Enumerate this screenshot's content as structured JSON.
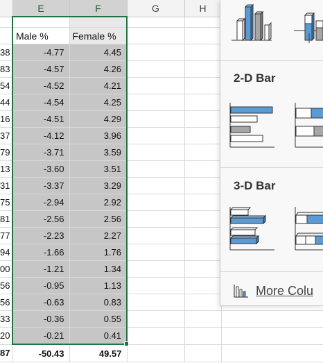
{
  "columns": [
    "E",
    "F",
    "G",
    "H"
  ],
  "headers": {
    "male": "Male %",
    "female": "Female %"
  },
  "rows": [
    {
      "rownum": "38",
      "male": "-4.77",
      "female": "4.45"
    },
    {
      "rownum": "83",
      "male": "-4.57",
      "female": "4.26"
    },
    {
      "rownum": "54",
      "male": "-4.52",
      "female": "4.21"
    },
    {
      "rownum": "44",
      "male": "-4.54",
      "female": "4.25"
    },
    {
      "rownum": "16",
      "male": "-4.51",
      "female": "4.29"
    },
    {
      "rownum": "37",
      "male": "-4.12",
      "female": "3.96"
    },
    {
      "rownum": "79",
      "male": "-3.71",
      "female": "3.59"
    },
    {
      "rownum": "13",
      "male": "-3.60",
      "female": "3.51"
    },
    {
      "rownum": "31",
      "male": "-3.37",
      "female": "3.29"
    },
    {
      "rownum": "75",
      "male": "-2.94",
      "female": "2.92"
    },
    {
      "rownum": "81",
      "male": "-2.56",
      "female": "2.56"
    },
    {
      "rownum": "77",
      "male": "-2.23",
      "female": "2.27"
    },
    {
      "rownum": "94",
      "male": "-1.66",
      "female": "1.76"
    },
    {
      "rownum": "00",
      "male": "-1.21",
      "female": "1.34"
    },
    {
      "rownum": "56",
      "male": "-0.95",
      "female": "1.13"
    },
    {
      "rownum": "56",
      "male": "-0.63",
      "female": "0.83"
    },
    {
      "rownum": "33",
      "male": "-0.36",
      "female": "0.55"
    },
    {
      "rownum": "20",
      "male": "-0.21",
      "female": "0.41"
    }
  ],
  "totals": {
    "rownum": "87",
    "male": "-50.43",
    "female": "49.57"
  },
  "chart_gallery": {
    "section_2d_bar": "2-D Bar",
    "section_3d_bar": "3-D Bar",
    "more_link": "More Colu",
    "thumbnails": [
      "3-d clustered column",
      "3-d stacked column",
      "clustered bar",
      "stacked bar",
      "3-d clustered bar",
      "3-d stacked bar"
    ],
    "icons": [
      "column-chart-icon"
    ]
  },
  "colors": {
    "selection_border": "#217346",
    "selection_fill": "#c6c6c6",
    "chart_blue": "#5b9bd5"
  }
}
